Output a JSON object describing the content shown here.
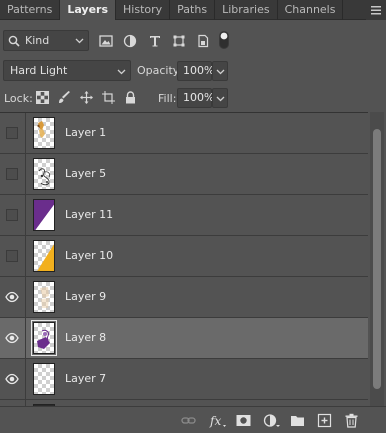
{
  "tabs": [
    {
      "label": "Patterns"
    },
    {
      "label": "Layers"
    },
    {
      "label": "History"
    },
    {
      "label": "Paths"
    },
    {
      "label": "Libraries"
    },
    {
      "label": "Channels"
    }
  ],
  "filter": {
    "kind_label": "Kind"
  },
  "blend": {
    "mode": "Hard Light",
    "opacity_label": "Opacity:",
    "opacity_value": "100%"
  },
  "lock": {
    "label": "Lock:",
    "fill_label": "Fill:",
    "fill_value": "100%"
  },
  "layers": [
    {
      "name": "Layer 1",
      "visible": false,
      "selected": false,
      "thumb": "figure"
    },
    {
      "name": "Layer 5",
      "visible": false,
      "selected": false,
      "thumb": "sketch"
    },
    {
      "name": "Layer 11",
      "visible": false,
      "selected": false,
      "thumb": "purple"
    },
    {
      "name": "Layer 10",
      "visible": false,
      "selected": false,
      "thumb": "yellow"
    },
    {
      "name": "Layer 9",
      "visible": true,
      "selected": false,
      "thumb": "faint"
    },
    {
      "name": "Layer 8",
      "visible": true,
      "selected": true,
      "thumb": "purple-figure"
    },
    {
      "name": "Layer 7",
      "visible": true,
      "selected": false,
      "thumb": "empty"
    }
  ],
  "colors": {
    "panel": "#535353",
    "tabbar": "#393939",
    "selected_row": "#6a6a6a",
    "purple": "#6a2d8c",
    "yellow": "#f2b01e"
  }
}
